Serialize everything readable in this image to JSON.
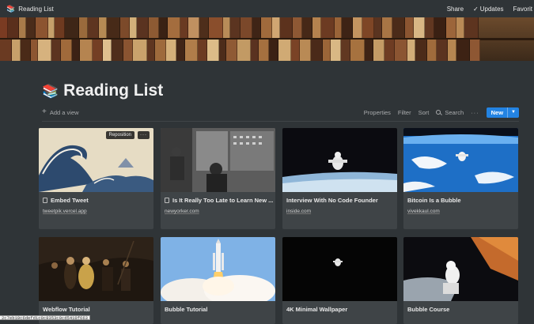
{
  "topbar": {
    "emoji": "📚",
    "crumb": "Reading List",
    "share": "Share",
    "updates": "Updates",
    "favorite": "Favorit"
  },
  "page": {
    "emoji": "📚",
    "title": "Reading List"
  },
  "toolbar": {
    "add_view": "Add a view",
    "properties": "Properties",
    "filter": "Filter",
    "sort": "Sort",
    "search": "Search",
    "more": "···",
    "new": "New"
  },
  "cards": [
    {
      "title": "Embed Tweet",
      "url": "tweetpik.vercel.app"
    },
    {
      "title": "Is It Really Too Late to Learn New ...",
      "url": "newyorker.com"
    },
    {
      "title": "Interview With No Code Founder",
      "url": "inside.com"
    },
    {
      "title": "Bitcoin Is a Bubble",
      "url": "vivekkaul.com"
    },
    {
      "title": "Webflow Tutorial",
      "url": ""
    },
    {
      "title": "Bubble Tutorial",
      "url": ""
    },
    {
      "title": "4K Minimal Wallpaper",
      "url": ""
    },
    {
      "title": "Bubble Course",
      "url": ""
    }
  ],
  "card_overlay": {
    "reposition": "Reposition",
    "more": "···"
  },
  "status_hash": "2c7eb10c6defd1c0c8353c0cd5410f663",
  "colors": {
    "background": "#2f3437",
    "card": "#3f4447",
    "accent": "#2383e2"
  }
}
